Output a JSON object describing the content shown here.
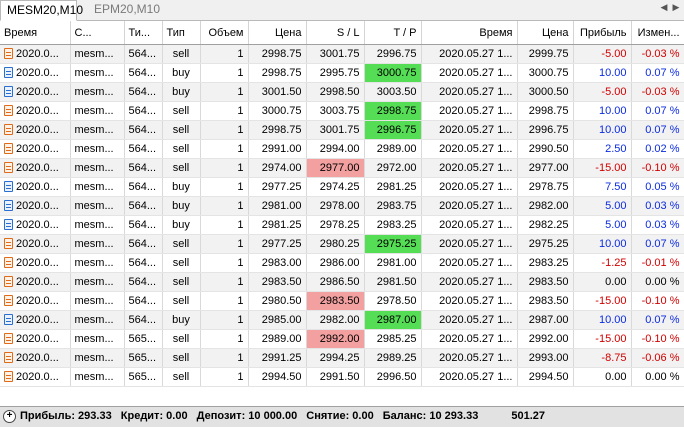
{
  "tabs": [
    {
      "label": "MESM20,M10",
      "active": true
    },
    {
      "label": "EPM20,M10",
      "active": false
    }
  ],
  "columns": [
    "Время",
    "С...",
    "Ти...",
    "Тип",
    "Объем",
    "Цена",
    "S / L",
    "T / P",
    "Время",
    "Цена",
    "Прибыль",
    "Измен..."
  ],
  "rows": [
    {
      "time": "2020.0...",
      "symbol": "mesm...",
      "ticket": "564...",
      "type": "sell",
      "volume": "1",
      "price": "2998.75",
      "sl": "3001.75",
      "tp": "2996.75",
      "close_time": "2020.05.27 1...",
      "close_price": "2999.75",
      "profit": "-5.00",
      "change": "-0.03 %",
      "hit": ""
    },
    {
      "time": "2020.0...",
      "symbol": "mesm...",
      "ticket": "564...",
      "type": "buy",
      "volume": "1",
      "price": "2998.75",
      "sl": "2995.75",
      "tp": "3000.75",
      "close_time": "2020.05.27 1...",
      "close_price": "3000.75",
      "profit": "10.00",
      "change": "0.07 %",
      "hit": "tp"
    },
    {
      "time": "2020.0...",
      "symbol": "mesm...",
      "ticket": "564...",
      "type": "buy",
      "volume": "1",
      "price": "3001.50",
      "sl": "2998.50",
      "tp": "3003.50",
      "close_time": "2020.05.27 1...",
      "close_price": "3000.50",
      "profit": "-5.00",
      "change": "-0.03 %",
      "hit": ""
    },
    {
      "time": "2020.0...",
      "symbol": "mesm...",
      "ticket": "564...",
      "type": "sell",
      "volume": "1",
      "price": "3000.75",
      "sl": "3003.75",
      "tp": "2998.75",
      "close_time": "2020.05.27 1...",
      "close_price": "2998.75",
      "profit": "10.00",
      "change": "0.07 %",
      "hit": "tp"
    },
    {
      "time": "2020.0...",
      "symbol": "mesm...",
      "ticket": "564...",
      "type": "sell",
      "volume": "1",
      "price": "2998.75",
      "sl": "3001.75",
      "tp": "2996.75",
      "close_time": "2020.05.27 1...",
      "close_price": "2996.75",
      "profit": "10.00",
      "change": "0.07 %",
      "hit": "tp"
    },
    {
      "time": "2020.0...",
      "symbol": "mesm...",
      "ticket": "564...",
      "type": "sell",
      "volume": "1",
      "price": "2991.00",
      "sl": "2994.00",
      "tp": "2989.00",
      "close_time": "2020.05.27 1...",
      "close_price": "2990.50",
      "profit": "2.50",
      "change": "0.02 %",
      "hit": ""
    },
    {
      "time": "2020.0...",
      "symbol": "mesm...",
      "ticket": "564...",
      "type": "sell",
      "volume": "1",
      "price": "2974.00",
      "sl": "2977.00",
      "tp": "2972.00",
      "close_time": "2020.05.27 1...",
      "close_price": "2977.00",
      "profit": "-15.00",
      "change": "-0.10 %",
      "hit": "sl"
    },
    {
      "time": "2020.0...",
      "symbol": "mesm...",
      "ticket": "564...",
      "type": "buy",
      "volume": "1",
      "price": "2977.25",
      "sl": "2974.25",
      "tp": "2981.25",
      "close_time": "2020.05.27 1...",
      "close_price": "2978.75",
      "profit": "7.50",
      "change": "0.05 %",
      "hit": ""
    },
    {
      "time": "2020.0...",
      "symbol": "mesm...",
      "ticket": "564...",
      "type": "buy",
      "volume": "1",
      "price": "2981.00",
      "sl": "2978.00",
      "tp": "2983.75",
      "close_time": "2020.05.27 1...",
      "close_price": "2982.00",
      "profit": "5.00",
      "change": "0.03 %",
      "hit": ""
    },
    {
      "time": "2020.0...",
      "symbol": "mesm...",
      "ticket": "564...",
      "type": "buy",
      "volume": "1",
      "price": "2981.25",
      "sl": "2978.25",
      "tp": "2983.25",
      "close_time": "2020.05.27 1...",
      "close_price": "2982.25",
      "profit": "5.00",
      "change": "0.03 %",
      "hit": ""
    },
    {
      "time": "2020.0...",
      "symbol": "mesm...",
      "ticket": "564...",
      "type": "sell",
      "volume": "1",
      "price": "2977.25",
      "sl": "2980.25",
      "tp": "2975.25",
      "close_time": "2020.05.27 1...",
      "close_price": "2975.25",
      "profit": "10.00",
      "change": "0.07 %",
      "hit": "tp"
    },
    {
      "time": "2020.0...",
      "symbol": "mesm...",
      "ticket": "564...",
      "type": "sell",
      "volume": "1",
      "price": "2983.00",
      "sl": "2986.00",
      "tp": "2981.00",
      "close_time": "2020.05.27 1...",
      "close_price": "2983.25",
      "profit": "-1.25",
      "change": "-0.01 %",
      "hit": ""
    },
    {
      "time": "2020.0...",
      "symbol": "mesm...",
      "ticket": "564...",
      "type": "sell",
      "volume": "1",
      "price": "2983.50",
      "sl": "2986.50",
      "tp": "2981.50",
      "close_time": "2020.05.27 1...",
      "close_price": "2983.50",
      "profit": "0.00",
      "change": "0.00 %",
      "hit": ""
    },
    {
      "time": "2020.0...",
      "symbol": "mesm...",
      "ticket": "564...",
      "type": "sell",
      "volume": "1",
      "price": "2980.50",
      "sl": "2983.50",
      "tp": "2978.50",
      "close_time": "2020.05.27 1...",
      "close_price": "2983.50",
      "profit": "-15.00",
      "change": "-0.10 %",
      "hit": "sl"
    },
    {
      "time": "2020.0...",
      "symbol": "mesm...",
      "ticket": "564...",
      "type": "buy",
      "volume": "1",
      "price": "2985.00",
      "sl": "2982.00",
      "tp": "2987.00",
      "close_time": "2020.05.27 1...",
      "close_price": "2987.00",
      "profit": "10.00",
      "change": "0.07 %",
      "hit": "tp"
    },
    {
      "time": "2020.0...",
      "symbol": "mesm...",
      "ticket": "565...",
      "type": "sell",
      "volume": "1",
      "price": "2989.00",
      "sl": "2992.00",
      "tp": "2985.25",
      "close_time": "2020.05.27 1...",
      "close_price": "2992.00",
      "profit": "-15.00",
      "change": "-0.10 %",
      "hit": "sl"
    },
    {
      "time": "2020.0...",
      "symbol": "mesm...",
      "ticket": "565...",
      "type": "sell",
      "volume": "1",
      "price": "2991.25",
      "sl": "2994.25",
      "tp": "2989.25",
      "close_time": "2020.05.27 1...",
      "close_price": "2993.00",
      "profit": "-8.75",
      "change": "-0.06 %",
      "hit": ""
    },
    {
      "time": "2020.0...",
      "symbol": "mesm...",
      "ticket": "565...",
      "type": "sell",
      "volume": "1",
      "price": "2994.50",
      "sl": "2991.50",
      "tp": "2996.50",
      "close_time": "2020.05.27 1...",
      "close_price": "2994.50",
      "profit": "0.00",
      "change": "0.00 %",
      "hit": ""
    }
  ],
  "footer": {
    "profit": "Прибыль: 293.33",
    "credit": "Кредит: 0.00",
    "deposit": "Депозит: 10 000.00",
    "withdrawal": "Снятие: 0.00",
    "balance": "Баланс: 10 293.33",
    "total": "501.27"
  },
  "colors": {
    "tp_hit": "#55dd55",
    "sl_hit": "#f2a0a0",
    "negative": "#d10000",
    "positive": "#0b2be0"
  }
}
